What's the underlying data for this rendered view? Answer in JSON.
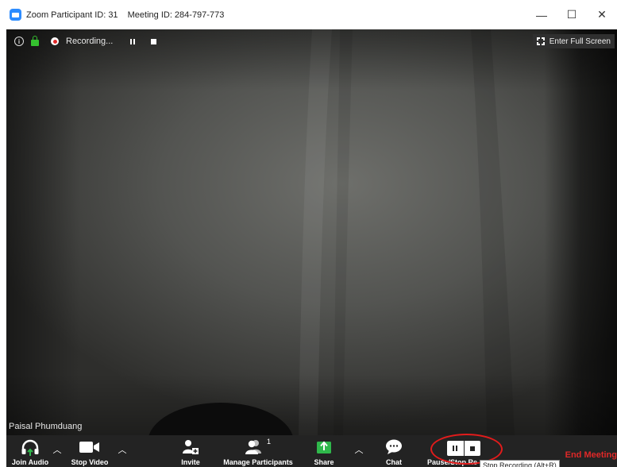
{
  "window": {
    "participant_id": "Zoom Participant ID: 31",
    "meeting_id": "Meeting ID: 284-797-773",
    "minimize": "—",
    "maximize": "☐",
    "close": "✕"
  },
  "overlay": {
    "recording_status": "Recording...",
    "full_screen_label": "Enter Full Screen",
    "participant_name": "Paisal Phumduang",
    "info_icon_glyph": "i"
  },
  "toolbar": {
    "join_audio": "Join Audio",
    "stop_video": "Stop Video",
    "invite": "Invite",
    "manage_participants": "Manage Participants",
    "participant_count": "1",
    "share": "Share",
    "chat": "Chat",
    "pause_stop_recording": "Pause/Stop Re",
    "end_meeting": "End Meeting",
    "caret_glyph": "︿"
  },
  "tooltip": {
    "text": "Stop Recording (Alt+R)"
  },
  "colors": {
    "toolbar_bg": "#232323",
    "video_bg": "#3b3b39",
    "accent_blue": "#2d8cff",
    "share_green": "#2fb84b",
    "end_red": "#e02828",
    "lock_green": "#35c12f"
  },
  "icons": {
    "app": "zoom-app-icon",
    "info": "info-icon",
    "lock": "lock-icon",
    "rec": "recording-dot-icon",
    "audio": "headphones-icon",
    "video": "camera-icon",
    "invite": "add-person-icon",
    "participants": "participants-icon",
    "share": "share-upload-icon",
    "chat": "chat-bubble-icon",
    "fullscreen": "fullscreen-icon"
  }
}
